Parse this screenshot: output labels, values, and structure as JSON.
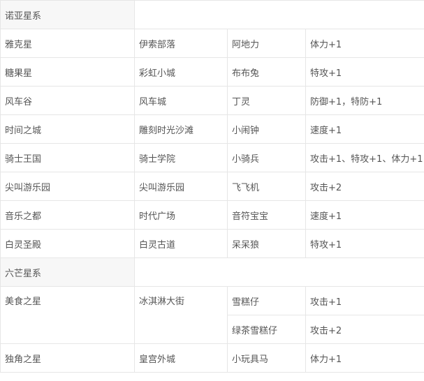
{
  "sections": [
    {
      "title": "诺亚星系",
      "rows": [
        {
          "planet": "雅克星",
          "area": "伊索部落",
          "pet": "阿地力",
          "bonus": "体力+1"
        },
        {
          "planet": "糖果星",
          "area": "彩虹小城",
          "pet": "布布兔",
          "bonus": "特攻+1"
        },
        {
          "planet": "风车谷",
          "area": "风车城",
          "pet": "丁灵",
          "bonus": "防御+1，特防+1"
        },
        {
          "planet": "时间之城",
          "area": "雕刻时光沙滩",
          "pet": "小闹钟",
          "bonus": "速度+1"
        },
        {
          "planet": "骑士王国",
          "area": "骑士学院",
          "pet": "小骑兵",
          "bonus": "攻击+1、特攻+1、体力+1"
        },
        {
          "planet": "尖叫游乐园",
          "area": "尖叫游乐园",
          "pet": "飞飞机",
          "bonus": "攻击+2"
        },
        {
          "planet": "音乐之都",
          "area": "时代广场",
          "pet": "音符宝宝",
          "bonus": "速度+1"
        },
        {
          "planet": "白灵圣殿",
          "area": "白灵古道",
          "pet": "呆呆狼",
          "bonus": "特攻+1"
        }
      ]
    },
    {
      "title": "六芒星系",
      "rows": [
        {
          "planet": "美食之星",
          "area": "冰淇淋大街",
          "pets": [
            {
              "pet": "雪糕仔",
              "bonus": "攻击+1"
            },
            {
              "pet": "绿茶雪糕仔",
              "bonus": "攻击+2"
            }
          ]
        },
        {
          "planet": "独角之星",
          "area": "皇宫外城",
          "pet": "小玩具马",
          "bonus": "体力+1"
        }
      ]
    }
  ]
}
